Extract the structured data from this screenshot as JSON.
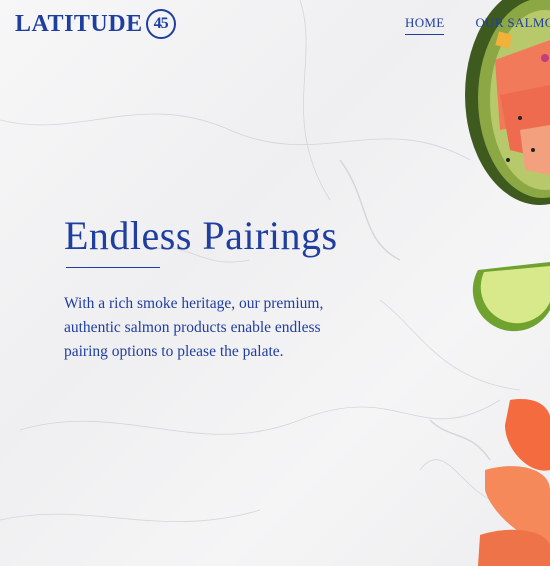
{
  "brand": {
    "name": "LATITUDE",
    "badge": "45"
  },
  "nav": {
    "items": [
      {
        "label": "HOME",
        "active": true
      },
      {
        "label": "OUR SALMON",
        "active": false
      }
    ]
  },
  "hero": {
    "title": "Endless Pairings",
    "body": "With a rich smoke heritage, our premium, authentic salmon products enable endless pairing options to please the palate."
  },
  "colors": {
    "brand_blue": "#1f3fa0",
    "background": "#f4f4f5"
  },
  "icons": {
    "logo_badge": "circle-45-badge"
  }
}
